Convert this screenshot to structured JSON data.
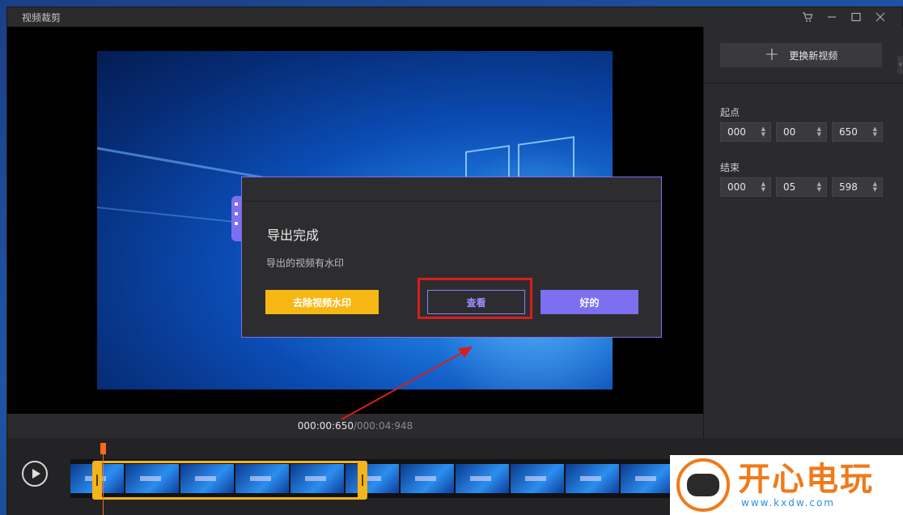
{
  "window": {
    "title": "视频裁剪",
    "controls": [
      "cart-icon",
      "minimize-icon",
      "maximize-icon",
      "close-icon"
    ]
  },
  "timebar": {
    "current": "000:00:650",
    "separator": " / ",
    "total": "000:04:948"
  },
  "sidebar": {
    "replace_label": "更换新视频",
    "start": {
      "label": "起点",
      "values": [
        "000",
        "00",
        "650"
      ]
    },
    "end": {
      "label": "结束",
      "values": [
        "000",
        "05",
        "598"
      ]
    }
  },
  "dialog": {
    "title": "导出完成",
    "message": "导出的视频有水印",
    "buttons": {
      "remove_watermark": "去除视频水印",
      "view": "查看",
      "ok": "好的"
    }
  },
  "colors": {
    "accent": "#7c6ff0",
    "remove_button": "#f7b712",
    "highlight": "#d81e1e",
    "playhead": "#ff6a1a"
  },
  "watermark": {
    "cn": "开心电玩",
    "url": "www.kxdw.com"
  }
}
